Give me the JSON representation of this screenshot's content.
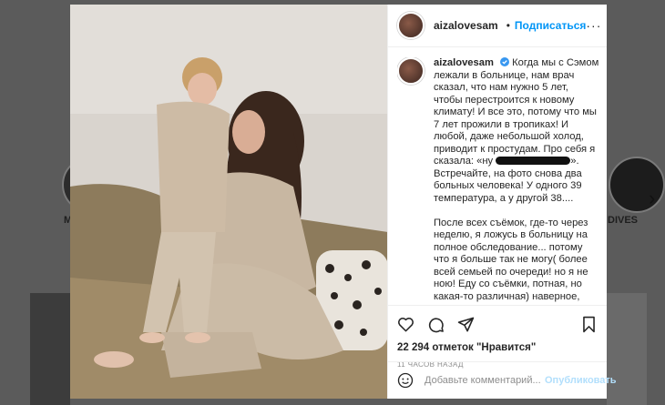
{
  "background": {
    "highlight_left": "M",
    "highlight_right": "DIVES"
  },
  "post": {
    "username": "aizalovesam",
    "follow_label": "Подписаться",
    "dot": "•",
    "more": "···",
    "caption": [
      "Когда мы с Сэмом лежали в больнице, нам врач сказал, что нам нужно 5 лет, чтобы перестроится к новому климату! И все это, потому что мы 7 лет прожили в тропиках! И любой, даже небольшой холод, приводит к простудам. Про себя я сказала: «ну",
      "». Встречайте, на фото снова два больных человека! У одного 39 температура, а у другой 38....",
      "После всех съёмок, где-то через неделю, я ложусь в больницу на полное обследование... потому что я больше так не могу( более всей семьей по очереди! но я не ною! Еду со съёмки, потная, но какая-то",
      "различная) наверное, потому что"
    ],
    "likes": "22 294 отметок \"Нравится\"",
    "time_ago": "11 ЧАСОВ НАЗАД",
    "comment_placeholder": "Добавьте комментарий...",
    "publish_label": "Опубликовать"
  },
  "icons": {
    "verified": "verified-badge-icon",
    "like": "heart-icon",
    "comment": "comment-icon",
    "share": "paper-plane-icon",
    "save": "bookmark-icon",
    "emoji": "smiley-icon",
    "next": "chevron-right-icon"
  },
  "colors": {
    "accent": "#0095f6",
    "publish_disabled": "#b2dffc",
    "text": "#262626",
    "muted": "#8e8e8e"
  }
}
